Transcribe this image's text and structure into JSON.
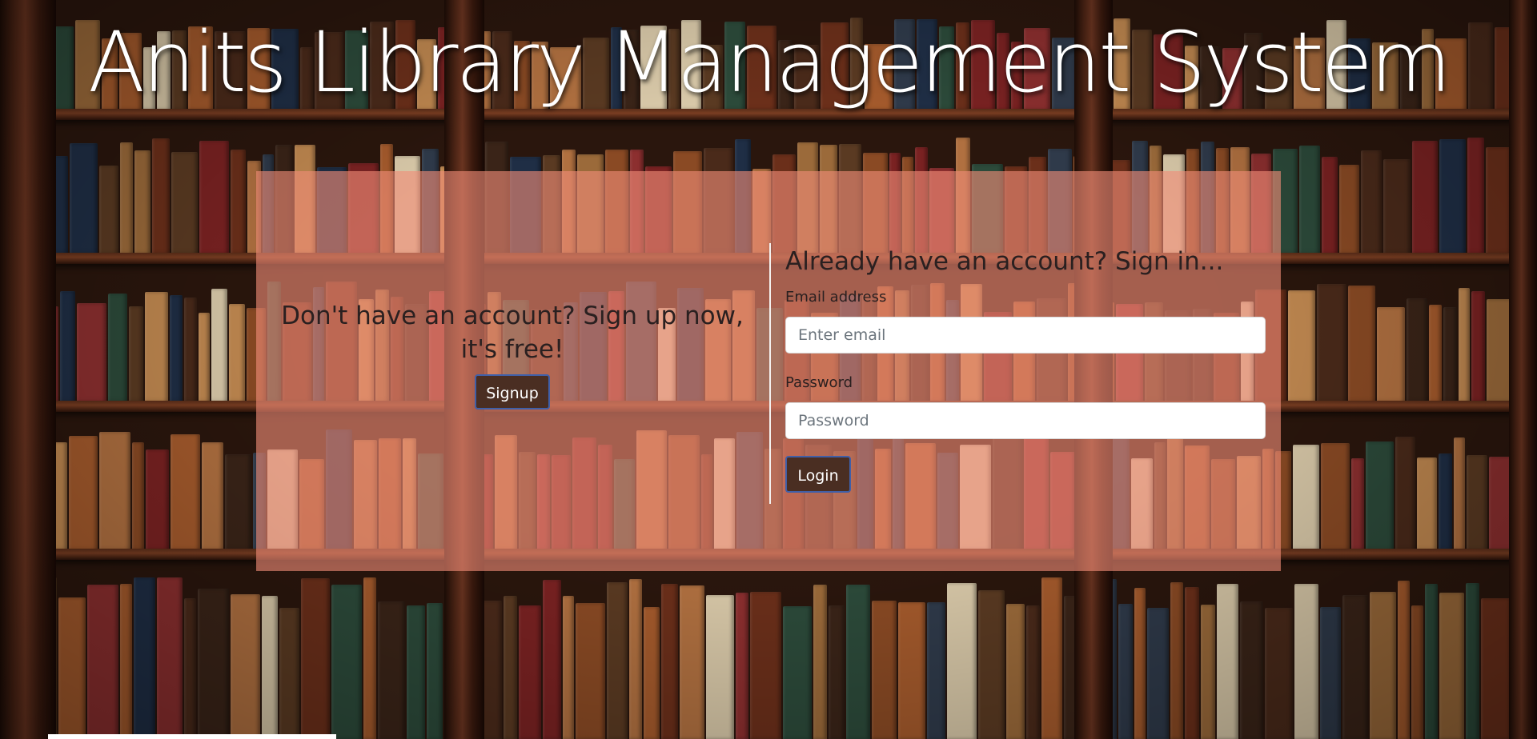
{
  "header": {
    "title": "Anits Library Management System"
  },
  "signup": {
    "prompt": "Don't have an account? Sign up now, it's free!",
    "button_label": "Signup"
  },
  "signin": {
    "heading": "Already have an account? Sign in...",
    "email_label": "Email address",
    "email_placeholder": "Enter email",
    "email_value": "",
    "password_label": "Password",
    "password_placeholder": "Password",
    "password_value": "",
    "button_label": "Login"
  },
  "colors": {
    "panel_overlay": "#f08c78",
    "button_bg": "#4a2e22",
    "button_border": "#3f5fa8",
    "title_text": "#ffffff"
  }
}
